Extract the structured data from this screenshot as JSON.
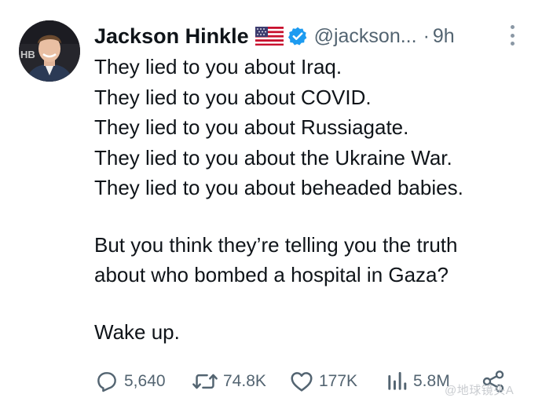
{
  "tweet": {
    "author_name": "Jackson Hinkle",
    "flag_icon": "us-flag-icon",
    "verified_color": "#1d9bf0",
    "handle": "@jackson...",
    "separator": "·",
    "time": "9h",
    "lines_block1": [
      "They lied to you about Iraq.",
      "They lied to you about COVID.",
      "They lied to you about Russiagate.",
      "They lied to you about the Ukraine War.",
      "They lied to you about beheaded babies."
    ],
    "lines_block2": [
      "But you think they’re telling you the truth",
      "about who bombed a hospital in Gaza?"
    ],
    "lines_block3": [
      "Wake up."
    ],
    "avatar_badge_text": "HB"
  },
  "actions": {
    "replies": "5,640",
    "reposts": "74.8K",
    "likes": "177K",
    "views": "5.8M"
  },
  "watermark": "@地球镜头A",
  "colors": {
    "text": "#0f1419",
    "secondary": "#536471",
    "accent": "#1d9bf0"
  }
}
